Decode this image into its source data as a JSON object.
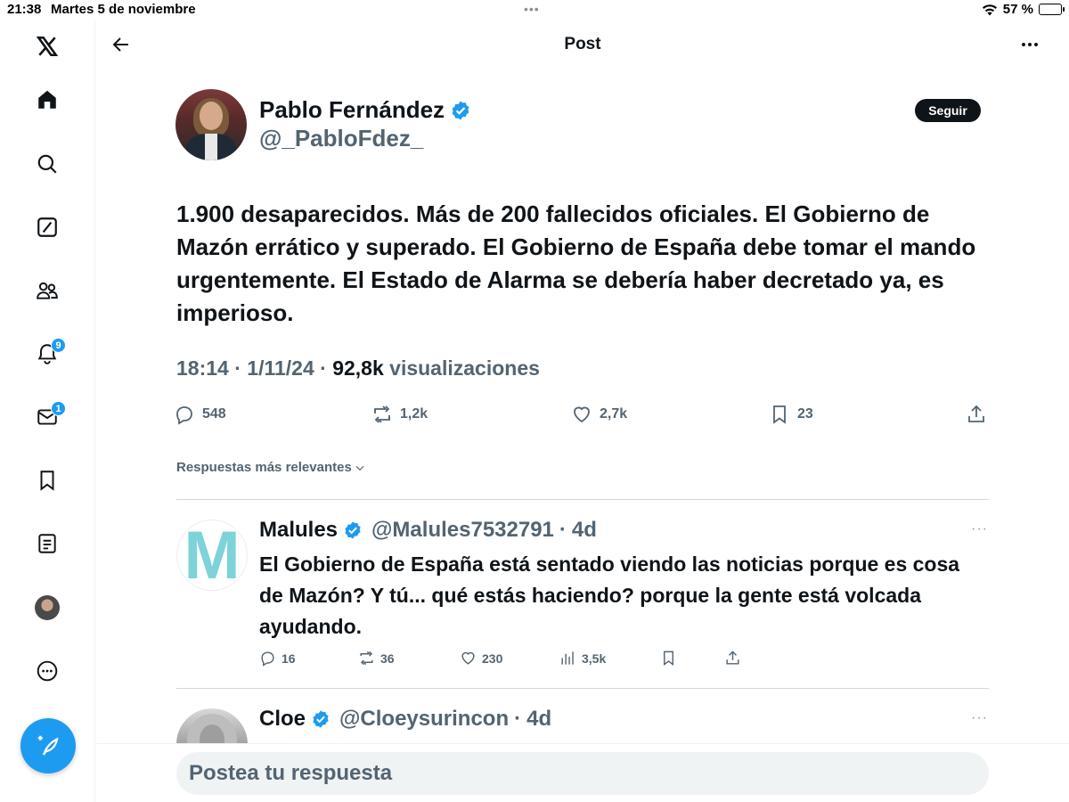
{
  "status_bar": {
    "time": "21:38",
    "date": "Martes 5 de noviembre",
    "dots": "•••",
    "battery": "57 %",
    "battery_level": 0.57
  },
  "sidebar": {
    "items": [
      {
        "name": "x-logo-icon"
      },
      {
        "name": "home-icon"
      },
      {
        "name": "search-icon"
      },
      {
        "name": "grok-icon"
      },
      {
        "name": "communities-icon"
      },
      {
        "name": "notifications-icon",
        "badge": "9"
      },
      {
        "name": "messages-icon",
        "badge": "1"
      },
      {
        "name": "bookmarks-icon"
      },
      {
        "name": "lists-icon"
      },
      {
        "name": "profile-avatar"
      },
      {
        "name": "more-icon"
      }
    ],
    "compose_icon": "compose-icon"
  },
  "header": {
    "title": "Post"
  },
  "post": {
    "author_name": "Pablo Fernández",
    "author_handle": "@_PabloFdez_",
    "follow_label": "Seguir",
    "text": "1.900 desaparecidos. Más de 200 fallecidos oficiales. El Gobierno de Mazón errático y superado. El Gobierno de España debe tomar el mando urgentemente. El Estado de Alarma se debería haber decretado ya, es imperioso.",
    "time": "18:14",
    "date": "1/11/24",
    "views_count": "92,8k",
    "views_label": "visualizaciones",
    "stats": {
      "replies": "548",
      "reposts": "1,2k",
      "likes": "2,7k",
      "bookmarks": "23"
    }
  },
  "sort_label": "Respuestas más relevantes",
  "replies": [
    {
      "name": "Malules",
      "handle": "@Malules7532791",
      "age": "4d",
      "avatar_letter": "M",
      "text": "El Gobierno de España está sentado viendo las noticias porque es cosa de Mazón? Y tú... qué estás haciendo? porque la gente está volcada ayudando.",
      "stats": {
        "replies": "16",
        "reposts": "36",
        "likes": "230",
        "views": "3,5k"
      }
    },
    {
      "name": "Cloe",
      "handle": "@Cloeysurincon",
      "age": "4d"
    }
  ],
  "reply_placeholder": "Postea tu respuesta",
  "colors": {
    "accent": "#1d9bf0",
    "text": "#0f1419",
    "secondary": "#536471"
  }
}
